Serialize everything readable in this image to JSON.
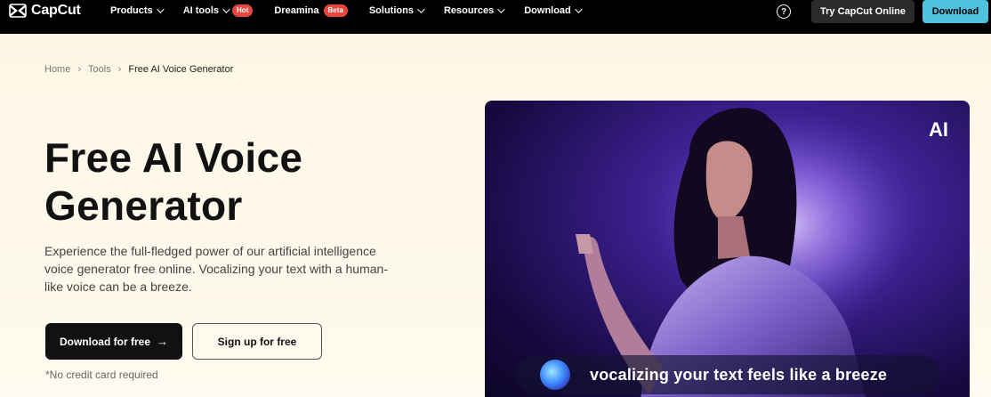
{
  "brand": {
    "name": "CapCut"
  },
  "nav": {
    "items": [
      {
        "label": "Products",
        "has_dropdown": true
      },
      {
        "label": "AI tools",
        "has_dropdown": true,
        "badge": "Hot"
      },
      {
        "label": "Dreamina",
        "has_dropdown": false,
        "badge": "Beta"
      },
      {
        "label": "Solutions",
        "has_dropdown": true
      },
      {
        "label": "Resources",
        "has_dropdown": true
      },
      {
        "label": "Download",
        "has_dropdown": true
      }
    ],
    "help_icon": "question-circle-icon",
    "try_online_label": "Try CapCut Online",
    "download_label": "Download",
    "colors": {
      "bar": "#000000",
      "badge": "#e8453c",
      "download_button": "#4fc3dd"
    }
  },
  "breadcrumb": {
    "items": [
      "Home",
      "Tools",
      "Free AI Voice Generator"
    ],
    "separator": "›"
  },
  "hero": {
    "title_line1": "Free AI Voice",
    "title_line2": "Generator",
    "desc_line1": "Experience the full-fledged power of our artificial intelligence",
    "desc_line2": "voice generator free online. Vocalizing your text with a human-",
    "desc_line3": "like voice can be a breeze.",
    "primary_button": "Download for free",
    "secondary_button": "Sign up for free",
    "note": "*No credit card required"
  },
  "media": {
    "corner_label": "AI",
    "caption": "vocalizing your text feels like a breeze",
    "image_subject": "woman in sequined jacket under purple light"
  }
}
